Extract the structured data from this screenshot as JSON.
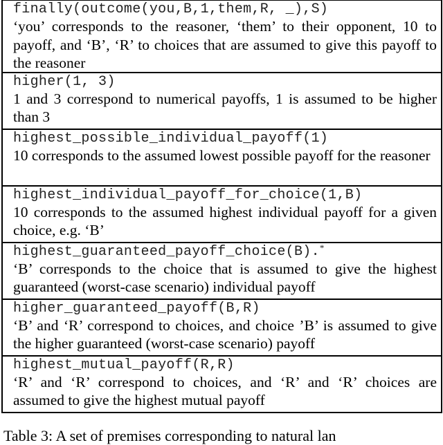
{
  "table": {
    "rows": [
      {
        "code": "finally(outcome(you,B,1,them,R, _),S)",
        "footnote_mark": "",
        "description": "‘you’ corresponds to the reasoner, ‘them’ to their opponent, 10 to payoff, and ‘B’, ‘R’ to choices that are assumed to give this payoff to the reasoner"
      },
      {
        "code": "higher(1, 3)",
        "footnote_mark": "",
        "description": "1 and 3 correspond to numerical payoffs, 1 is assumed to be higher than 3"
      },
      {
        "code": "highest_possible_individual_payoff(1)",
        "footnote_mark": "",
        "description": "10 corresponds to the assumed lowest possible payoff for the reasoner"
      },
      {
        "code": "highest_individual_payoff_for_choice(1,B)",
        "footnote_mark": "",
        "description": "10 corresponds to the assumed highest individual payoff for a given choice, e.g. ‘B’"
      },
      {
        "code": "highest_guaranteed_payoff_choice(B).",
        "footnote_mark": "*",
        "description": "‘B’ corresponds to the choice that is assumed to give the highest guaranteed (worst-case scenario) individual payoff"
      },
      {
        "code": "higher_guaranteed_payoff(B,R)",
        "footnote_mark": "",
        "description": "‘B’ and ‘R’ correspond to choices, and choice ’B’ is assumed to give the higher guaranteed (worst-case scenario) payoff"
      },
      {
        "code": "highest_mutual_payoff(R,R)",
        "footnote_mark": "",
        "description": "‘R’ and ‘R’ correspond to choices, and ‘R’ and ‘R’ choices are assumed to give the highest mutual payoff"
      }
    ]
  },
  "caption": "Table 3: A set of premises corresponding to natural lan"
}
